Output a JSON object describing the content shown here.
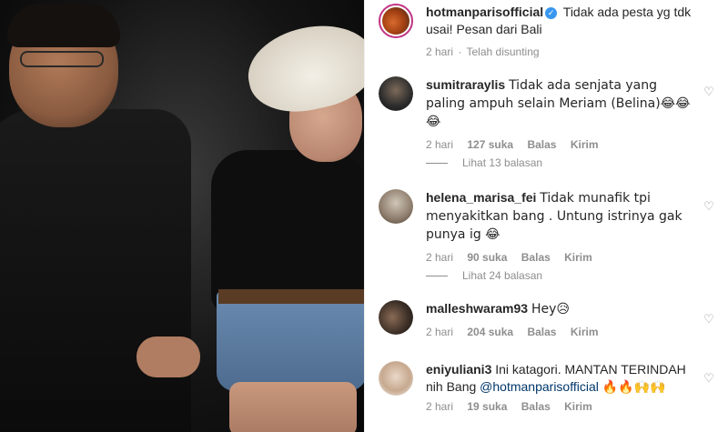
{
  "photo": {
    "alt": ""
  },
  "post": {
    "username": "hotmanparisofficial",
    "caption": "Tidak ada pesta yg tdk usai! Pesan dari Bali",
    "time": "2 hari",
    "edited": "Telah disunting"
  },
  "comments": [
    {
      "username": "sumitraraylis",
      "text": "Tidak ada senjata yang paling ampuh selain Meriam (Belina)😂😂😂",
      "time": "2 hari",
      "likes": "127 suka",
      "reply_label": "Balas",
      "send_label": "Kirim",
      "view_replies": "Lihat 13 balasan"
    },
    {
      "username": "helena_marisa_fei",
      "text": "Tidak munafik tpi menyakitkan bang . Untung istrinya gak punya ig 😂",
      "time": "2 hari",
      "likes": "90 suka",
      "reply_label": "Balas",
      "send_label": "Kirim",
      "view_replies": "Lihat 24 balasan"
    },
    {
      "username": "malleshwaram93",
      "text": "Hey😥",
      "time": "2 hari",
      "likes": "204 suka",
      "reply_label": "Balas",
      "send_label": "Kirim"
    },
    {
      "username": "eniyuliani3",
      "text": "Ini katagori. MANTAN TERINDAH nih Bang ",
      "mention": "@hotmanparisofficial",
      "text_after": "🔥🔥🙌🙌",
      "time": "2 hari",
      "likes": "19 suka",
      "reply_label": "Balas",
      "send_label": "Kirim"
    }
  ],
  "icons": {
    "verified": "verified-badge-icon",
    "like": "heart-icon"
  },
  "colors": {
    "verified": "#3897f0",
    "meta": "#8e8e8e",
    "mention": "#00376b",
    "story_ring": "#c13584"
  }
}
